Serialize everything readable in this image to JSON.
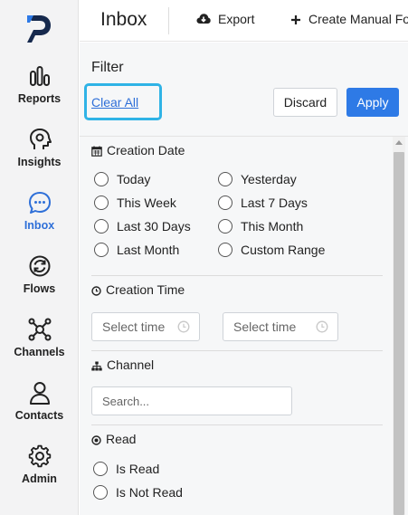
{
  "sidebar": {
    "items": [
      {
        "label": "Reports",
        "icon": "bar-chart-icon"
      },
      {
        "label": "Insights",
        "icon": "head-gear-icon"
      },
      {
        "label": "Inbox",
        "icon": "chat-bubble-icon",
        "active": true
      },
      {
        "label": "Flows",
        "icon": "cycle-arrows-icon"
      },
      {
        "label": "Channels",
        "icon": "network-nodes-icon"
      },
      {
        "label": "Contacts",
        "icon": "person-icon"
      },
      {
        "label": "Admin",
        "icon": "gear-icon"
      }
    ]
  },
  "topbar": {
    "title": "Inbox",
    "export_label": "Export",
    "create_label": "Create Manual Fo"
  },
  "filter": {
    "title": "Filter",
    "clear_all": "Clear All",
    "discard": "Discard",
    "apply": "Apply",
    "creation_date": {
      "label": "Creation Date",
      "options": [
        "Today",
        "Yesterday",
        "This Week",
        "Last 7 Days",
        "Last 30 Days",
        "This Month",
        "Last Month",
        "Custom Range"
      ]
    },
    "creation_time": {
      "label": "Creation Time",
      "from_placeholder": "Select time",
      "to_placeholder": "Select time"
    },
    "channel": {
      "label": "Channel",
      "search_placeholder": "Search..."
    },
    "read": {
      "label": "Read",
      "options": [
        "Is Read",
        "Is Not Read"
      ]
    }
  },
  "colors": {
    "accent": "#2e7ae6",
    "active_nav": "#2e6fd8",
    "highlight": "#2fb3e6",
    "sidebar_bg": "#f3f3f4"
  }
}
